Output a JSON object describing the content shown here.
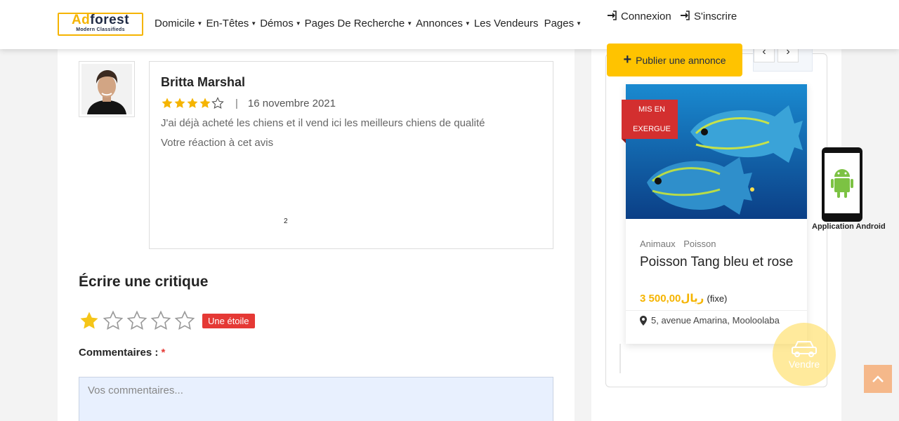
{
  "header": {
    "logo": {
      "brand_ad": "Ad",
      "brand_rest": "forest",
      "tagline": "Modern Classifieds"
    },
    "nav": [
      {
        "label": "Domicile",
        "dropdown": true
      },
      {
        "label": "En-Têtes",
        "dropdown": true
      },
      {
        "label": "Démos",
        "dropdown": true
      },
      {
        "label": "Pages De Recherche",
        "dropdown": true
      },
      {
        "label": "Annonces",
        "dropdown": true
      },
      {
        "label": "Les Vendeurs",
        "dropdown": false
      },
      {
        "label": "Pages",
        "dropdown": true
      }
    ],
    "login": "Connexion",
    "register": "S'inscrire",
    "publish": "Publier une annonce"
  },
  "review": {
    "author": "Britta Marshal",
    "rating": 4,
    "max_rating": 5,
    "separator": "|",
    "date": "16 novembre 2021",
    "text": "J'ai déjà acheté les chiens et il vend ici les meilleurs chiens de qualité",
    "reaction": "Votre réaction à cet avis",
    "number": "2"
  },
  "write_review": {
    "title": "Écrire une critique",
    "selected_rating": 1,
    "rating_badge": "Une étoile",
    "comments_label": "Commentaires :",
    "required_mark": "*",
    "comments_placeholder": "Vos commentaires..."
  },
  "sidebar": {
    "featured_badge_line1": "MIS EN",
    "featured_badge_line2": "EXERGUE",
    "categories": [
      "Animaux",
      "Poisson"
    ],
    "title": "Poisson Tang bleu et rose",
    "price": "3 500,00ريال",
    "price_note": "(fixe)",
    "location": "5, avenue Amarina, Mooloolaba",
    "sell_label": "Vendre"
  },
  "android": {
    "label": "Application Android"
  },
  "colors": {
    "accent": "#ffc300",
    "badge_red": "#e53935",
    "ribbon": "#d32f2f",
    "price": "#f5b400"
  }
}
